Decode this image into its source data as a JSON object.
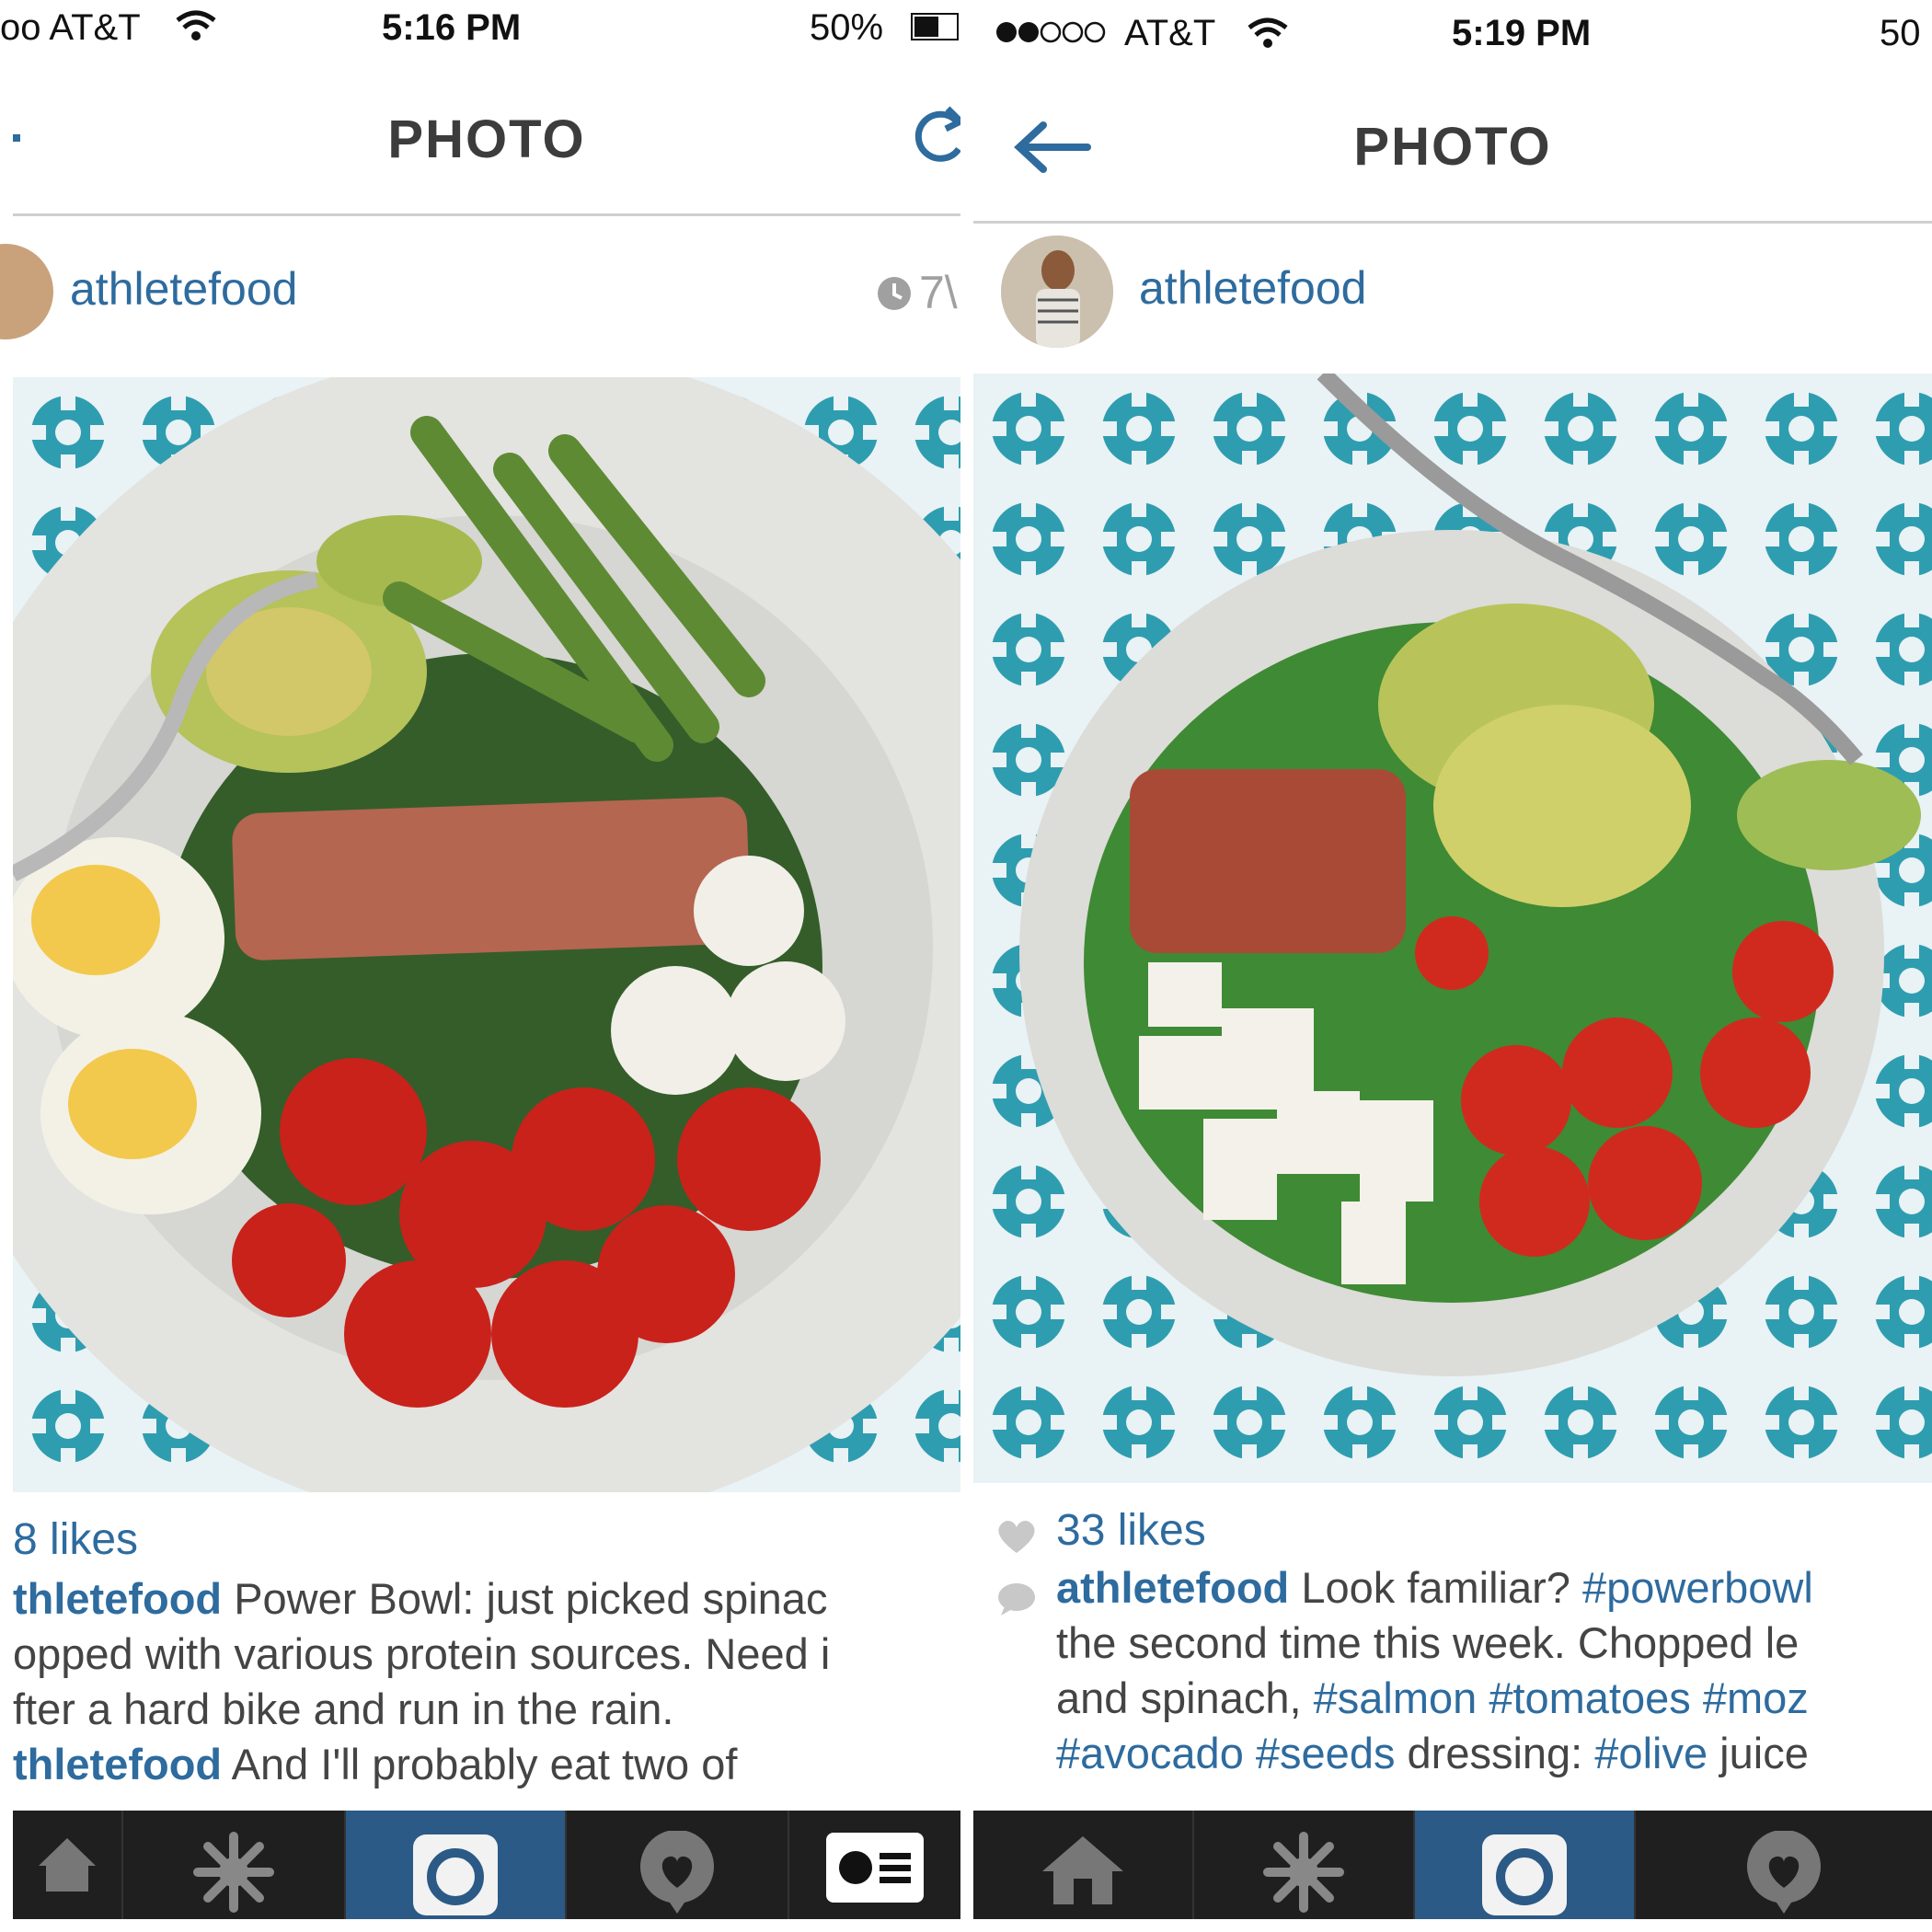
{
  "left": {
    "status": {
      "carrier": "oo AT&T",
      "time": "5:16 PM",
      "battery": "50%"
    },
    "nav": {
      "title": "PHOTO"
    },
    "post": {
      "username": "athletefood",
      "time_ago": "7\\",
      "likes": "8 likes",
      "caption_user": "thletefood",
      "caption_line1": " Power Bowl: just picked spinac",
      "caption_line2": "opped with various protein sources. Need i",
      "caption_line3": "fter a hard bike and run in the rain.",
      "comment_user": "thletefood",
      "comment_text": " And I'll probably eat two of"
    },
    "tabs": [
      "home-tab",
      "explore-tab",
      "camera-tab",
      "activity-tab",
      "profile-tab"
    ]
  },
  "right": {
    "status": {
      "carrier": "AT&T",
      "time": "5:19 PM",
      "battery": "50"
    },
    "nav": {
      "title": "PHOTO"
    },
    "post": {
      "username": "athletefood",
      "likes": "33 likes",
      "caption_user": "athletefood",
      "caption_text": " Look familiar? ",
      "tag_powerbowl": "#powerbowl",
      "line2": "the second time this week. Chopped le",
      "line3_text": "and spinach, ",
      "tag_salmon": "#salmon",
      "tag_tomatoes": "#tomatoes",
      "tag_moz": "#moz",
      "tag_avocado": "#avocado",
      "tag_seeds": "#seeds",
      "line4_text": " dressing: ",
      "tag_olive": "#olive",
      "line4_end": " juice"
    }
  },
  "colors": {
    "accent": "#2e6b9e",
    "tab_active": "#2b5a86",
    "tabbar": "#1f1f1f"
  }
}
